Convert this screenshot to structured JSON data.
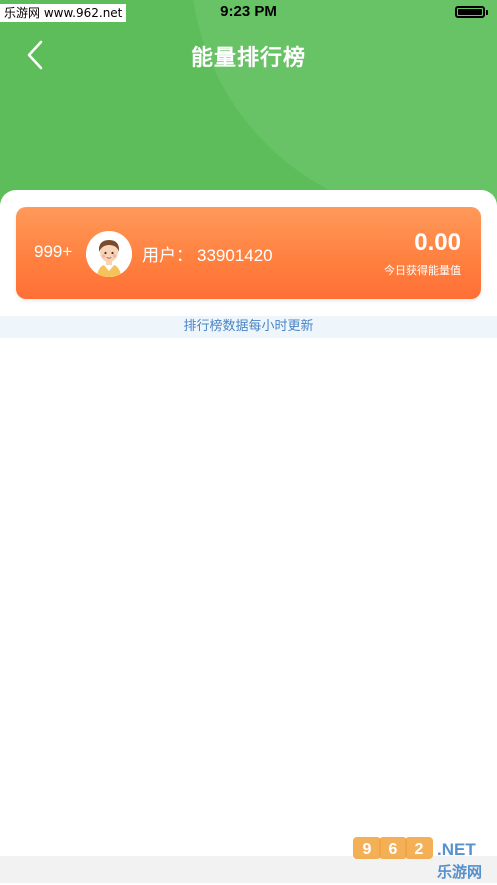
{
  "status_bar": {
    "site_tag": "乐游网 www.962.net",
    "time": "9:23 PM",
    "battery_level": 1.0
  },
  "nav": {
    "title": "能量排行榜",
    "back_icon": "chevron-left-icon"
  },
  "my_rank": {
    "rank": "999+",
    "user_label": "用户：",
    "user_id": "33901420",
    "energy_value": "0.00",
    "energy_label": "今日获得能量值"
  },
  "update_notice": "排行榜数据每小时更新",
  "watermark": {
    "brand": "962.NET",
    "sub": "乐游网"
  },
  "colors": {
    "header_green": "#5cbd5a",
    "card_orange": "#ff8448",
    "notice_text": "#4a84c4",
    "notice_bg": "#eef5fb"
  }
}
